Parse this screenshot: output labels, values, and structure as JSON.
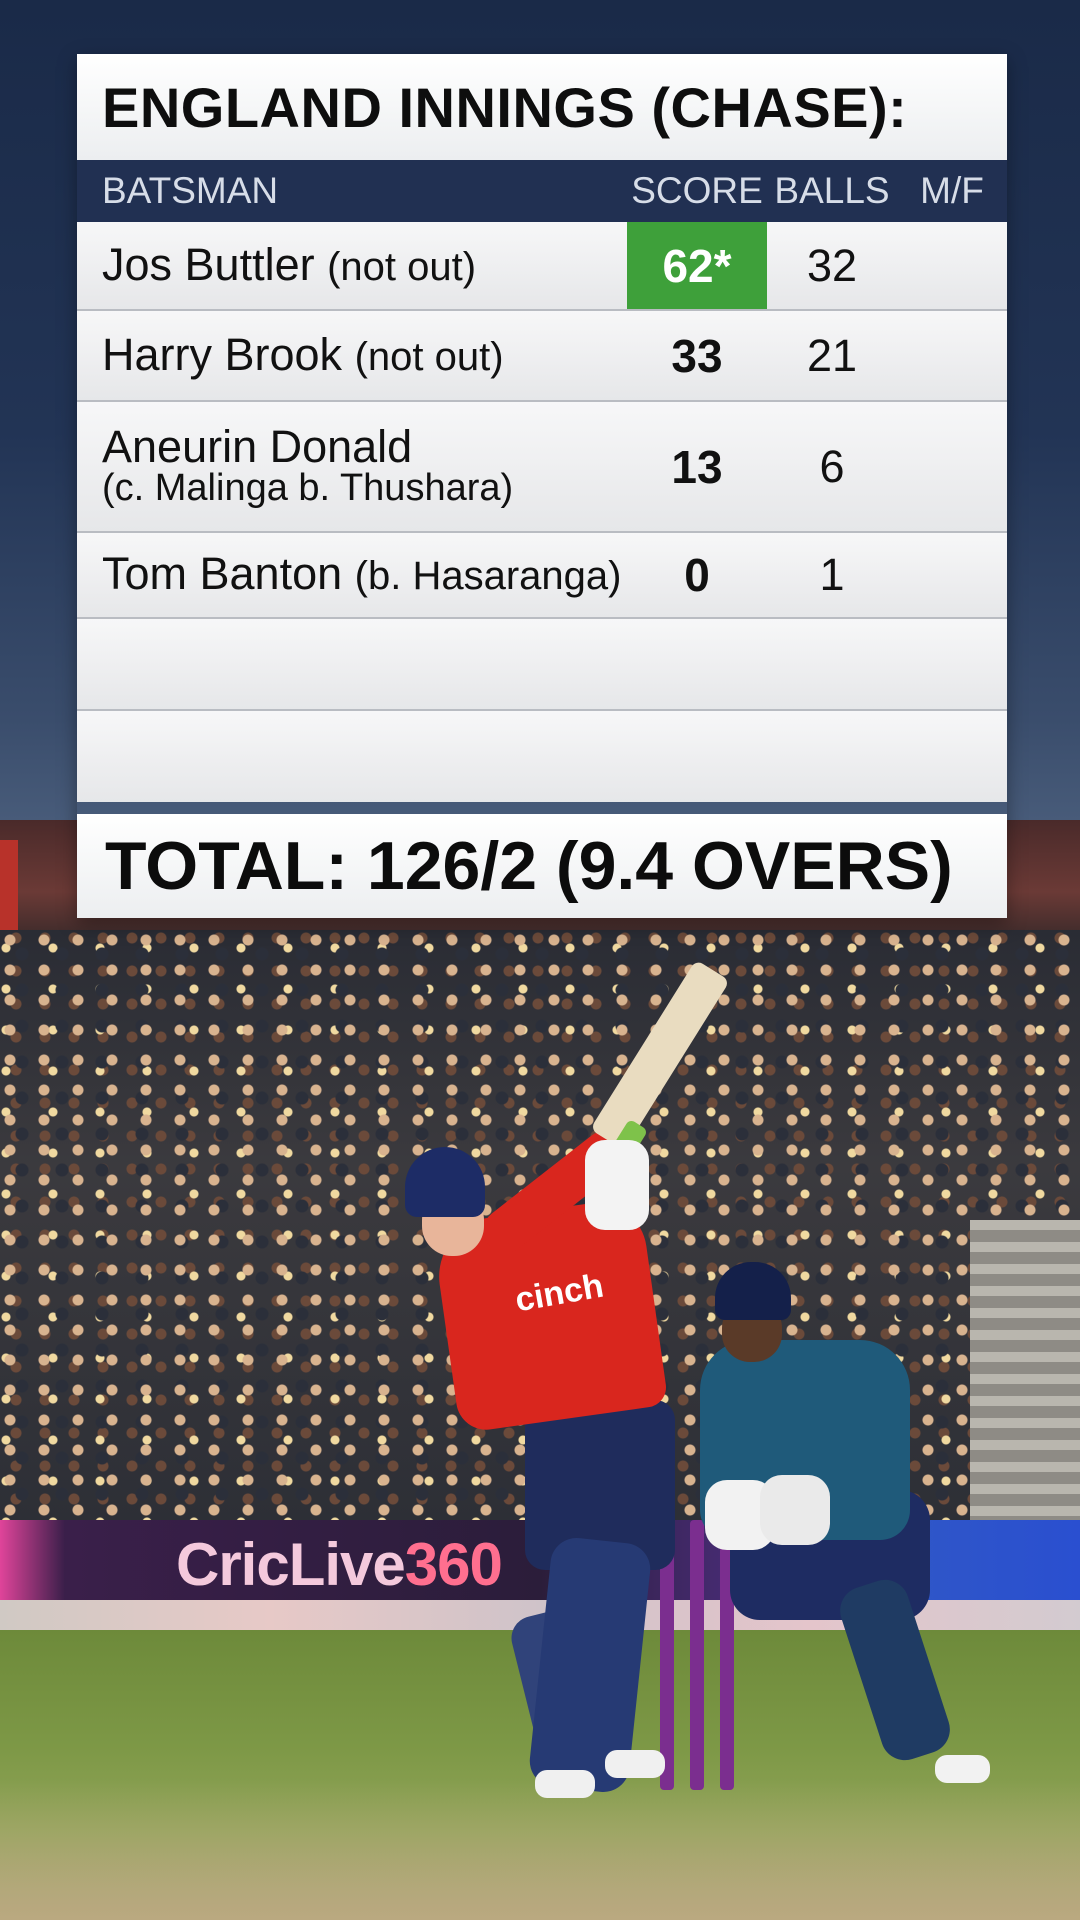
{
  "scoreboard": {
    "title": "ENGLAND INNINGS (CHASE):",
    "headers": {
      "batsman": "BATSMAN",
      "score": "SCORE",
      "balls": "BALLS",
      "mf": "M/F"
    },
    "rows": [
      {
        "name": "Jos Buttler",
        "dismissal": "(not out)",
        "score": "62*",
        "balls": "32",
        "mf": ""
      },
      {
        "name": "Harry Brook",
        "dismissal": "(not out)",
        "score": "33",
        "balls": "21",
        "mf": ""
      },
      {
        "name": "Aneurin Donald",
        "dismissal": "(c. Malinga b. Thushara)",
        "score": "13",
        "balls": "6",
        "mf": ""
      },
      {
        "name": "Tom Banton",
        "dismissal": "(b. Hasaranga)",
        "score": "0",
        "balls": "1",
        "mf": ""
      }
    ],
    "highlight_color": "#3ea03a",
    "total": "TOTAL: 126/2 (9.4 OVERS)"
  },
  "background": {
    "ad_board": {
      "part1": "CricLive",
      "part2": "360"
    },
    "batsman_shirt_sponsor": "cinch"
  }
}
